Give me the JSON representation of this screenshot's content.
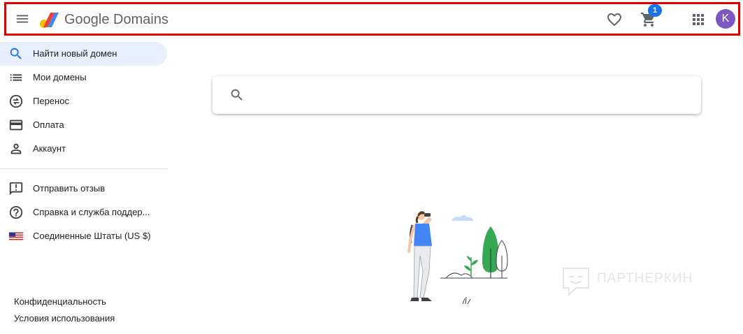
{
  "header": {
    "logo_text": "Google Domains",
    "cart_count": "1",
    "avatar_letter": "K"
  },
  "sidebar": {
    "items": [
      {
        "label": "Найти новый домен",
        "icon": "search-icon",
        "active": true
      },
      {
        "label": "Мои домены",
        "icon": "list-icon"
      },
      {
        "label": "Перенос",
        "icon": "transfer-icon"
      },
      {
        "label": "Оплата",
        "icon": "credit-card-icon"
      },
      {
        "label": "Аккаунт",
        "icon": "person-icon"
      }
    ],
    "secondary_items": [
      {
        "label": "Отправить отзыв",
        "icon": "feedback-icon"
      },
      {
        "label": "Справка и служба поддер...",
        "icon": "help-icon"
      },
      {
        "label": "Соединенные Штаты (US $)",
        "icon": "us-flag-icon"
      }
    ],
    "footer": {
      "privacy": "Конфиденциальность",
      "terms": "Условия использования"
    }
  },
  "main": {
    "search": {
      "value": "",
      "placeholder": ""
    }
  },
  "watermark": {
    "text": "ПАРТНЕРКИН"
  },
  "colors": {
    "accent": "#1a73e8",
    "active_bg": "#e8f0fe",
    "header_border": "#e00000",
    "avatar": "#7e57c2"
  }
}
